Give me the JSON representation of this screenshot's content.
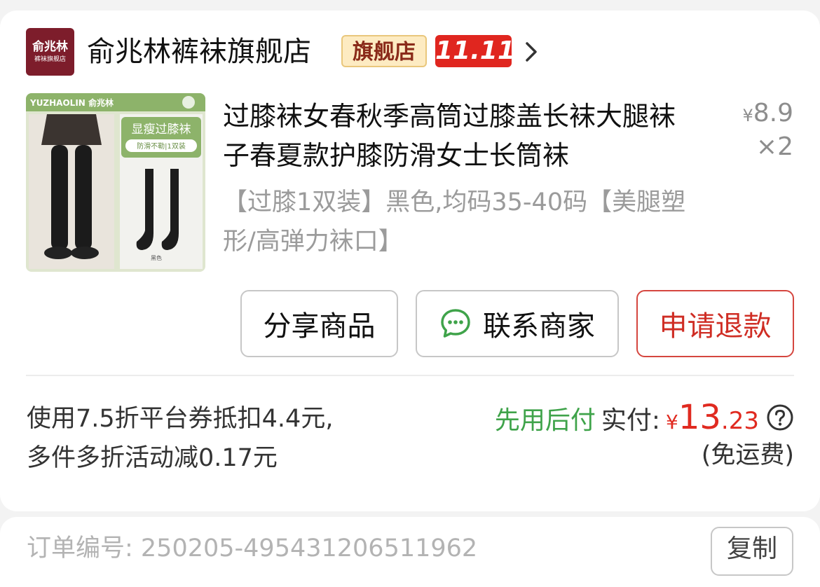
{
  "shop": {
    "logo_line1": "俞兆林",
    "logo_line2": "裤袜旗舰店",
    "name": "俞兆林裤袜旗舰店",
    "flagship_badge": "旗舰店",
    "promo_badge": "11.11"
  },
  "product": {
    "image_brand": "YUZHAOLIN 俞兆林",
    "image_tag": "显瘦过膝袜",
    "image_subtag": "防滑不勒|1双装",
    "image_color": "黑色",
    "title": "过膝袜女春秋季高筒过膝盖长袜大腿袜子春夏款护膝防滑女士长筒袜",
    "price_symbol": "¥",
    "price": "8.9",
    "quantity": "×2",
    "sku": "【过膝1双装】黑色,均码35-40码【美腿塑形/高弹力袜口】"
  },
  "actions": {
    "share": "分享商品",
    "contact": "联系商家",
    "refund": "申请退款"
  },
  "payment": {
    "discount_note": "使用7.5折平台券抵扣4.4元, 多件多折活动减0.17元",
    "pay_later": "先用后付",
    "paid_label": "实付:",
    "currency": "¥",
    "amount_int": "13",
    "amount_dec": ".23",
    "shipping": "(免运费)"
  },
  "order": {
    "number_text": "订单编号:  250205-495431206511962",
    "copy_label": "复制"
  },
  "colors": {
    "accent_red": "#e0261f",
    "pay_later_green": "#3fa34a",
    "logo_bg": "#7d1d2b"
  }
}
